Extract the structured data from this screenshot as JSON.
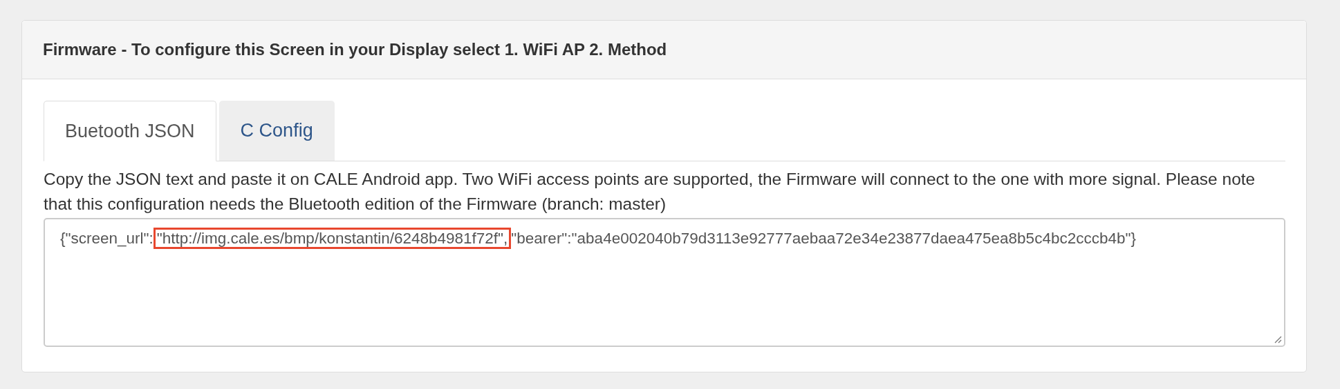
{
  "panel": {
    "title": "Firmware - To configure this Screen in your Display select 1. WiFi AP 2. Method"
  },
  "tabs": [
    {
      "label": "Buetooth JSON",
      "selected": true
    },
    {
      "label": "C Config",
      "selected": false
    }
  ],
  "description": "Copy the JSON text and paste it on CALE Android app. Two WiFi access points are supported, the Firmware will connect to the one with more signal. Please note that this configuration needs the Bluetooth edition of the Firmware (branch: master)",
  "json_field": {
    "prefix": "{\"screen_url\":",
    "highlighted": "\"http://img.cale.es/bmp/konstantin/6248b4981f72f\",",
    "suffix": "\"bearer\":\"aba4e002040b79d3113e92777aebaa72e34e23877daea475ea8b5c4bc2cccb4b\"}"
  }
}
